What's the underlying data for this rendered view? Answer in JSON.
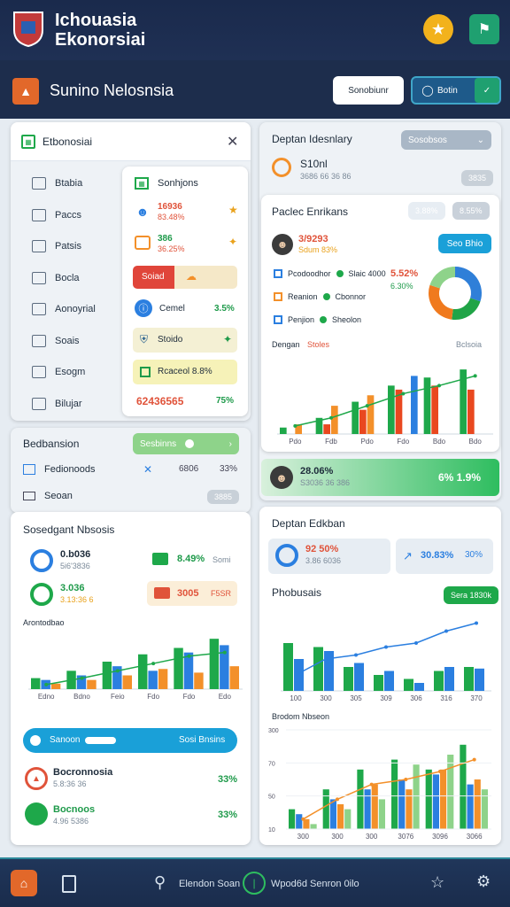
{
  "header": {
    "title_line1": "Ichouasia",
    "title_line2": "Ekonorsiai",
    "logo_icon": "shield-crest-icon",
    "right_icons": [
      "trophy-icon",
      "flag-badge-icon"
    ]
  },
  "subheader": {
    "title": "Sunino Nelosnsia",
    "logo_icon": "crest-icon",
    "button_label": "Sonobiunr",
    "toggle_label": "Botin",
    "accent": "#1fa070"
  },
  "sidebar_card": {
    "title": "Etbonosiai",
    "nav": [
      {
        "label": "Btabia",
        "icon": "doc-icon"
      },
      {
        "label": "Paccs",
        "icon": "calendar-icon"
      },
      {
        "label": "Patsis",
        "icon": "shirt-icon"
      },
      {
        "label": "Bocla",
        "icon": "tools-icon"
      },
      {
        "label": "Aonoyrial",
        "icon": "chat-icon"
      },
      {
        "label": "Soais",
        "icon": "list-icon"
      },
      {
        "label": "Esogm",
        "icon": "book-icon"
      },
      {
        "label": "Bilujar",
        "icon": "pen-icon"
      }
    ],
    "panel_title": "Sonhjons",
    "rows": [
      {
        "value": "16936",
        "sub": "83.48%",
        "color": "#e0533a"
      },
      {
        "value": "386",
        "sub": "36.25%",
        "color": "#1e9a4a"
      },
      {
        "value": "Soiad",
        "sub": ""
      },
      {
        "value": "Cemel",
        "sub": "3.5%"
      },
      {
        "value": "Stoido",
        "sub": ""
      },
      {
        "value": "Rcaceol 8.8%",
        "sub": ""
      },
      {
        "value": "62436565",
        "sub": "75%"
      }
    ]
  },
  "top_right_card": {
    "title": "Deptan Idesnlary",
    "select_label": "Sosobsos",
    "metric": "S10nl",
    "metric_sub": "3686 66 36 86",
    "chip": "3835",
    "chart_title": "Paclec Enrikans",
    "chips": [
      "3.88%",
      "8.55%"
    ],
    "hero_value": "3/9293",
    "hero_sub": "Sdum 83%",
    "hero_button": "Seo Bhio",
    "legend": [
      {
        "label": "Pcodoodhor",
        "sub": "Slaic 4000"
      },
      {
        "label": "Reanion",
        "sub": "Cbonnor"
      },
      {
        "label": "Penjion",
        "sub": "Sheolon"
      }
    ],
    "side_pct": "5.52%",
    "side_pct2": "6.30%",
    "donut": {
      "segments": [
        {
          "value": 30,
          "color": "#2f7fd8"
        },
        {
          "value": 22,
          "color": "#20a447"
        },
        {
          "value": 28,
          "color": "#f07a1e"
        },
        {
          "value": 20,
          "color": "#8ed38a"
        }
      ]
    },
    "bars_title": "Dengan",
    "bars_title_accent": "Stoles",
    "bars_right": "Bclsoia",
    "bar_chart": {
      "categories": [
        "Pdo",
        "Fdb",
        "Pdo",
        "Fdo",
        "Bdo",
        "Bdo"
      ],
      "series": [
        {
          "color": "#1ea84a",
          "values": [
            8,
            20,
            40,
            60,
            70,
            80
          ]
        },
        {
          "color": "#e9481f",
          "values": [
            0,
            12,
            30,
            55,
            60,
            55
          ]
        },
        {
          "color": "#f3902a",
          "values": [
            12,
            35,
            48,
            0,
            0,
            0
          ]
        },
        {
          "color": "#2b7fe0",
          "values": [
            0,
            0,
            0,
            72,
            0,
            0
          ]
        }
      ],
      "tops": [
        "3",
        "3",
        "3",
        "3"
      ]
    },
    "footer_value": "28.06%",
    "footer_sub": "S3036 36 386",
    "footer_right": "6% 1.9%"
  },
  "left_mid": {
    "title": "Bedbansion",
    "pill": "Sesbinns",
    "rows": [
      {
        "label": "Fedionoods",
        "value": "6806",
        "pct": "33%"
      },
      {
        "label": "Seoan",
        "value": "3885"
      }
    ]
  },
  "left_bottom": {
    "title": "Sosedgant Nbsosis",
    "stats": [
      {
        "value": "0.b036",
        "sub": "5i6'3836",
        "right": "8.49%",
        "right_sub": "Somi"
      },
      {
        "value": "3.036",
        "sub": "3.13:36 6",
        "right": "3005",
        "right_sub": "F5SR"
      }
    ],
    "chart_title": "Arontodbao",
    "bar_chart": {
      "categories": [
        "Edno",
        "Bdno",
        "Feio",
        "Fdo",
        "Fdo",
        "Edo"
      ],
      "series": [
        {
          "color": "#1ea84a",
          "values": [
            12,
            20,
            30,
            38,
            45,
            55
          ]
        },
        {
          "color": "#2b7fe0",
          "values": [
            10,
            15,
            25,
            20,
            40,
            48
          ]
        },
        {
          "color": "#f3902a",
          "values": [
            6,
            10,
            15,
            22,
            18,
            25
          ]
        }
      ],
      "line": [
        5,
        12,
        20,
        28,
        36,
        40
      ]
    },
    "progress_label": "Sanoon",
    "progress_right": "Sosi Bnsins",
    "progress_value": 0.35,
    "list": [
      {
        "label": "Bocronnosia",
        "sub": "5.8:36 36",
        "pct": "33%"
      },
      {
        "label": "Bocnoos",
        "sub": "4.96 5386",
        "pct": "33%"
      }
    ]
  },
  "right_bottom": {
    "title": "Deptan Edkban",
    "kpis": [
      {
        "value": "92 50%",
        "sub": "3.86 6036"
      },
      {
        "value": "30.83%",
        "sub": "30%"
      }
    ],
    "chart1_title": "Phobusais",
    "chart1_badge": "Sera 1830k",
    "chart1": {
      "categories": [
        "100",
        "300",
        "305",
        "309",
        "306",
        "316",
        "370"
      ],
      "series": [
        {
          "color": "#1ea84a",
          "values": [
            60,
            55,
            30,
            20,
            15,
            25,
            30
          ]
        },
        {
          "color": "#2b7fe0",
          "values": [
            40,
            50,
            35,
            25,
            10,
            30,
            28
          ]
        }
      ],
      "line": [
        20,
        40,
        45,
        55,
        60,
        75,
        85
      ]
    },
    "chart2_title": "Brodom Nbseon",
    "chart2": {
      "categories": [
        "300",
        "300",
        "300",
        "3076",
        "3096",
        "3066"
      ],
      "series": [
        {
          "color": "#1ea84a",
          "values": [
            20,
            40,
            60,
            70,
            60,
            85
          ]
        },
        {
          "color": "#2b7fe0",
          "values": [
            15,
            30,
            40,
            50,
            55,
            45
          ]
        },
        {
          "color": "#f3902a",
          "values": [
            10,
            25,
            45,
            40,
            60,
            50
          ]
        },
        {
          "color": "#8ed38a",
          "values": [
            5,
            20,
            30,
            65,
            75,
            40
          ]
        }
      ],
      "line": [
        10,
        30,
        45,
        50,
        58,
        70
      ],
      "yticks": [
        "300",
        "70",
        "50",
        "10"
      ]
    }
  },
  "bottombar": {
    "search_label": "Elendon Soan",
    "status_label": "Wpod6d Senron 0ilo",
    "icons": [
      "home-crest-icon",
      "doc-icon",
      "search-icon",
      "loading-icon",
      "star-icon",
      "gear-icon"
    ]
  }
}
